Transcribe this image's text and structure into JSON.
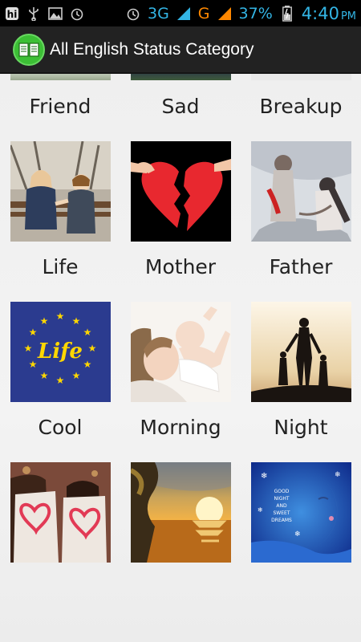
{
  "statusbar": {
    "network_3g": "3G",
    "network_g": "G",
    "battery_pct": "37%",
    "time": "4:40",
    "ampm": "PM",
    "icons": [
      "hike-icon",
      "usb-icon",
      "image-icon",
      "alarm-icon",
      "alarm-icon",
      "signal-icon",
      "battery-icon"
    ]
  },
  "actionbar": {
    "title": "All English Status Category",
    "app_icon": "book-icon"
  },
  "grid": {
    "row1_labels": [
      "Friend",
      "Sad",
      "Breakup"
    ],
    "row2_labels": [
      "Life",
      "Mother",
      "Father"
    ],
    "row3_labels": [
      "Cool",
      "Morning",
      "Night"
    ],
    "row2_images": [
      "kids-image",
      "broken-heart-image",
      "couple-sketch-image"
    ],
    "row3_images": [
      "life-europe-stars-image",
      "mother-baby-image",
      "family-silhouette-image"
    ],
    "row4_images": [
      "heart-tshirt-couple-image",
      "sunset-sea-image",
      "moon-good-night-image"
    ],
    "moon_text": "GOOD NIGHT AND SWEET DREAMS",
    "life_text": "Life"
  }
}
